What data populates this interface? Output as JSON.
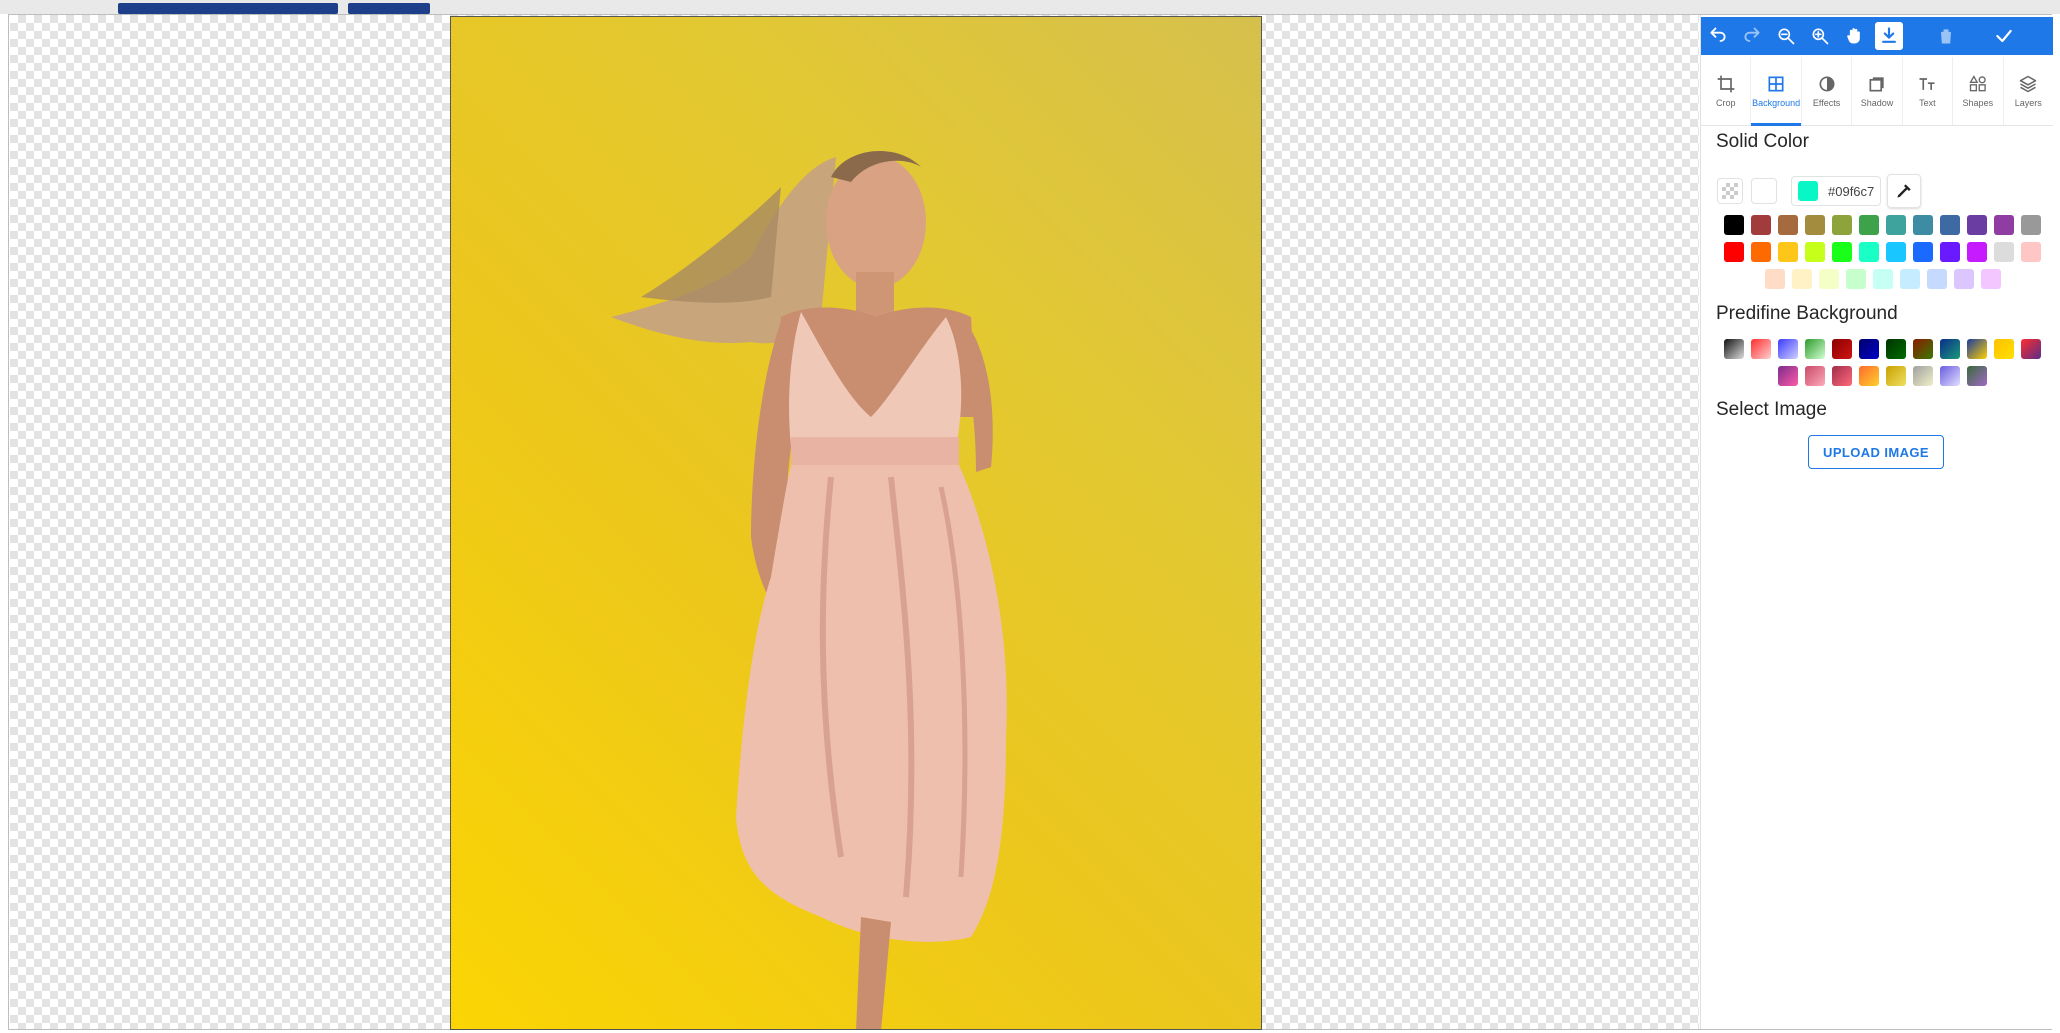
{
  "toolbar": {
    "buttons": [
      {
        "icon": "undo-icon"
      },
      {
        "icon": "redo-icon"
      },
      {
        "icon": "zoom-out-icon"
      },
      {
        "icon": "zoom-in-icon"
      },
      {
        "icon": "hand-icon"
      },
      {
        "icon": "download-icon"
      },
      {
        "icon": "trash-icon"
      },
      {
        "icon": "check-icon"
      }
    ],
    "accent": "#1e78e8"
  },
  "tabs": [
    {
      "label": "Crop",
      "icon": "crop-icon"
    },
    {
      "label": "Background",
      "icon": "grid-icon",
      "active": true
    },
    {
      "label": "Effects",
      "icon": "contrast-icon"
    },
    {
      "label": "Shadow",
      "icon": "shadow-icon"
    },
    {
      "label": "Text",
      "icon": "text-icon"
    },
    {
      "label": "Shapes",
      "icon": "shapes-icon"
    },
    {
      "label": "Layers",
      "icon": "layers-icon"
    }
  ],
  "solid": {
    "title": "Solid Color",
    "hex": "#09f6c7"
  },
  "palette": [
    "#000000",
    "#a23b3b",
    "#a56a3e",
    "#a38c3d",
    "#8fa33c",
    "#3ea24a",
    "#3ea39c",
    "#3d8ca3",
    "#3d6aa3",
    "#6a3da3",
    "#8f3da3",
    "#999999",
    "#ff0000",
    "#ff6a00",
    "#ffc61a",
    "#c6ff1a",
    "#1aff1a",
    "#1affc6",
    "#1ac6ff",
    "#1a6aff",
    "#6a1aff",
    "#c61aff",
    "#dcdcdc",
    "#ffc6c6",
    "#ffdcc6",
    "#fff3c6",
    "#f3ffc6",
    "#c6ffcc",
    "#c6fff3",
    "#c6ecff",
    "#c6d9ff",
    "#dcc6ff",
    "#f3c6ff"
  ],
  "predefined": {
    "title": "Predifine Background",
    "gradients": [
      [
        "#111111",
        "#dddddd"
      ],
      [
        "#ff2d2d",
        "#ffd0d0"
      ],
      [
        "#3a3aff",
        "#d0d0ff"
      ],
      [
        "#2d9a2d",
        "#d0ffd0"
      ],
      [
        "#8b0000",
        "#d01414"
      ],
      [
        "#00006b",
        "#0000c8"
      ],
      [
        "#003300",
        "#006d00"
      ],
      [
        "#8c1a00",
        "#3a7a00"
      ],
      [
        "#0a2d8a",
        "#1a9a7a"
      ],
      [
        "#1a3aa0",
        "#ffd000"
      ],
      [
        "#ffc000",
        "#ffe000"
      ],
      [
        "#ff2d2d",
        "#5a2d8a"
      ],
      [
        "#7a2d8a",
        "#ff5aaa"
      ],
      [
        "#c84a6a",
        "#ffaaba"
      ],
      [
        "#a02d4a",
        "#ff6a7a"
      ],
      [
        "#ff6a2d",
        "#ffd02d"
      ],
      [
        "#c8a000",
        "#f0e060"
      ],
      [
        "#a0a0a0",
        "#f0f0c8"
      ],
      [
        "#6a5ae0",
        "#e0e0ff"
      ],
      [
        "#3a6a3a",
        "#a06ac8"
      ]
    ]
  },
  "image_section": {
    "title": "Select Image",
    "upload_label": "UPLOAD IMAGE"
  }
}
